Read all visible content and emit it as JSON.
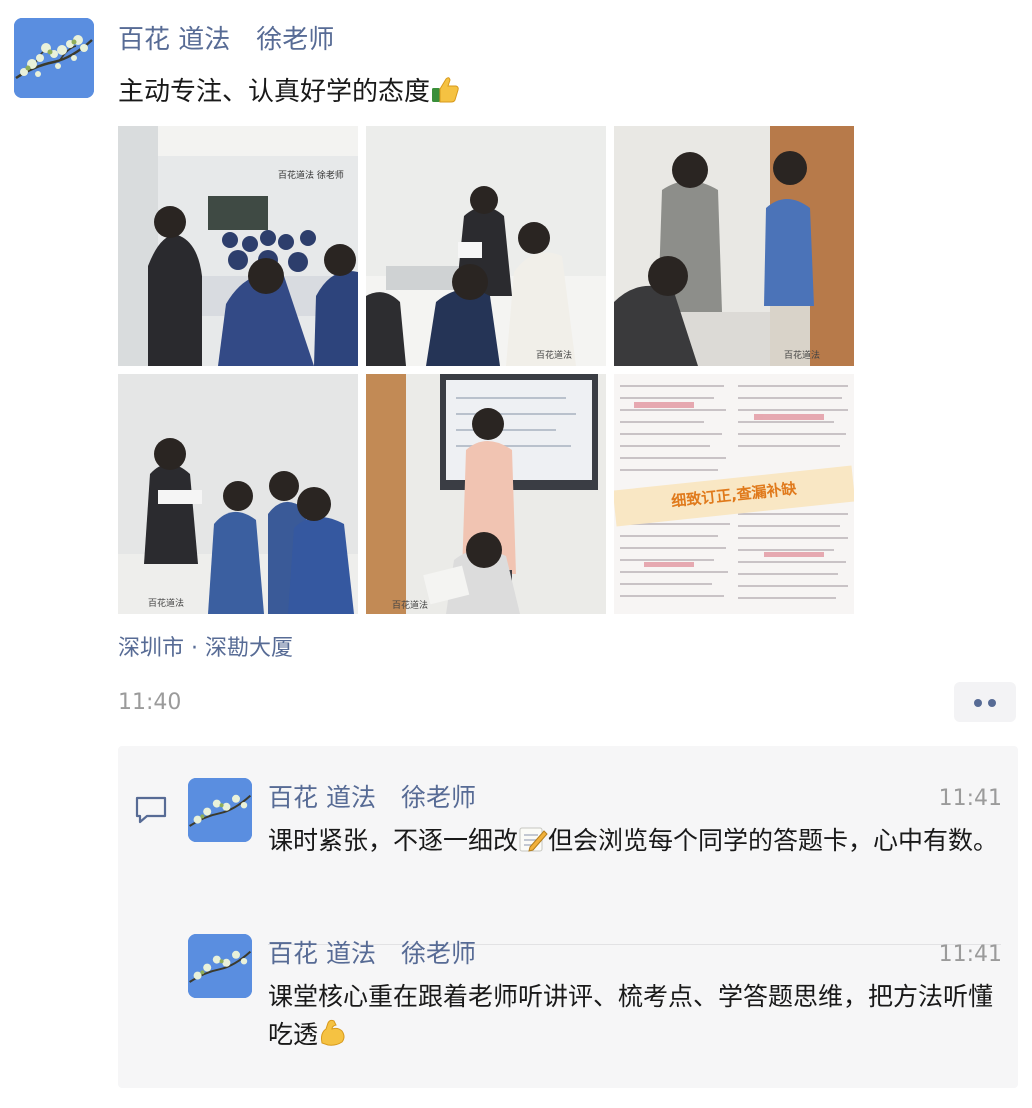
{
  "post": {
    "author": "百花 道法　徐老师",
    "text": "主动专注、认真好学的态度",
    "emoji": "thumbs-up",
    "location": "深圳市 · 深勘大厦",
    "time": "11:40",
    "photos": [
      {
        "caption": "百花道法 徐老师"
      },
      {
        "caption": "百花道法"
      },
      {
        "caption": "百花道法"
      },
      {
        "caption": "百花道法"
      },
      {
        "caption": "百花道法"
      },
      {
        "caption": "细致订正,查漏补缺"
      }
    ]
  },
  "comments": [
    {
      "author": "百花 道法　徐老师",
      "time": "11:41",
      "text_before": "课时紧张，不逐一细改",
      "emoji": "memo",
      "text_after": "但会浏览每个同学的答题卡，心中有数。"
    },
    {
      "author": "百花 道法　徐老师",
      "time": "11:41",
      "text_before": "课堂核心重在跟着老师听讲评、梳考点、学答题思维，把方法听懂吃透",
      "emoji": "flexed-biceps",
      "text_after": ""
    }
  ],
  "colors": {
    "link": "#576b95",
    "time": "#9b9b9b",
    "comment_bg": "#f6f6f7"
  }
}
